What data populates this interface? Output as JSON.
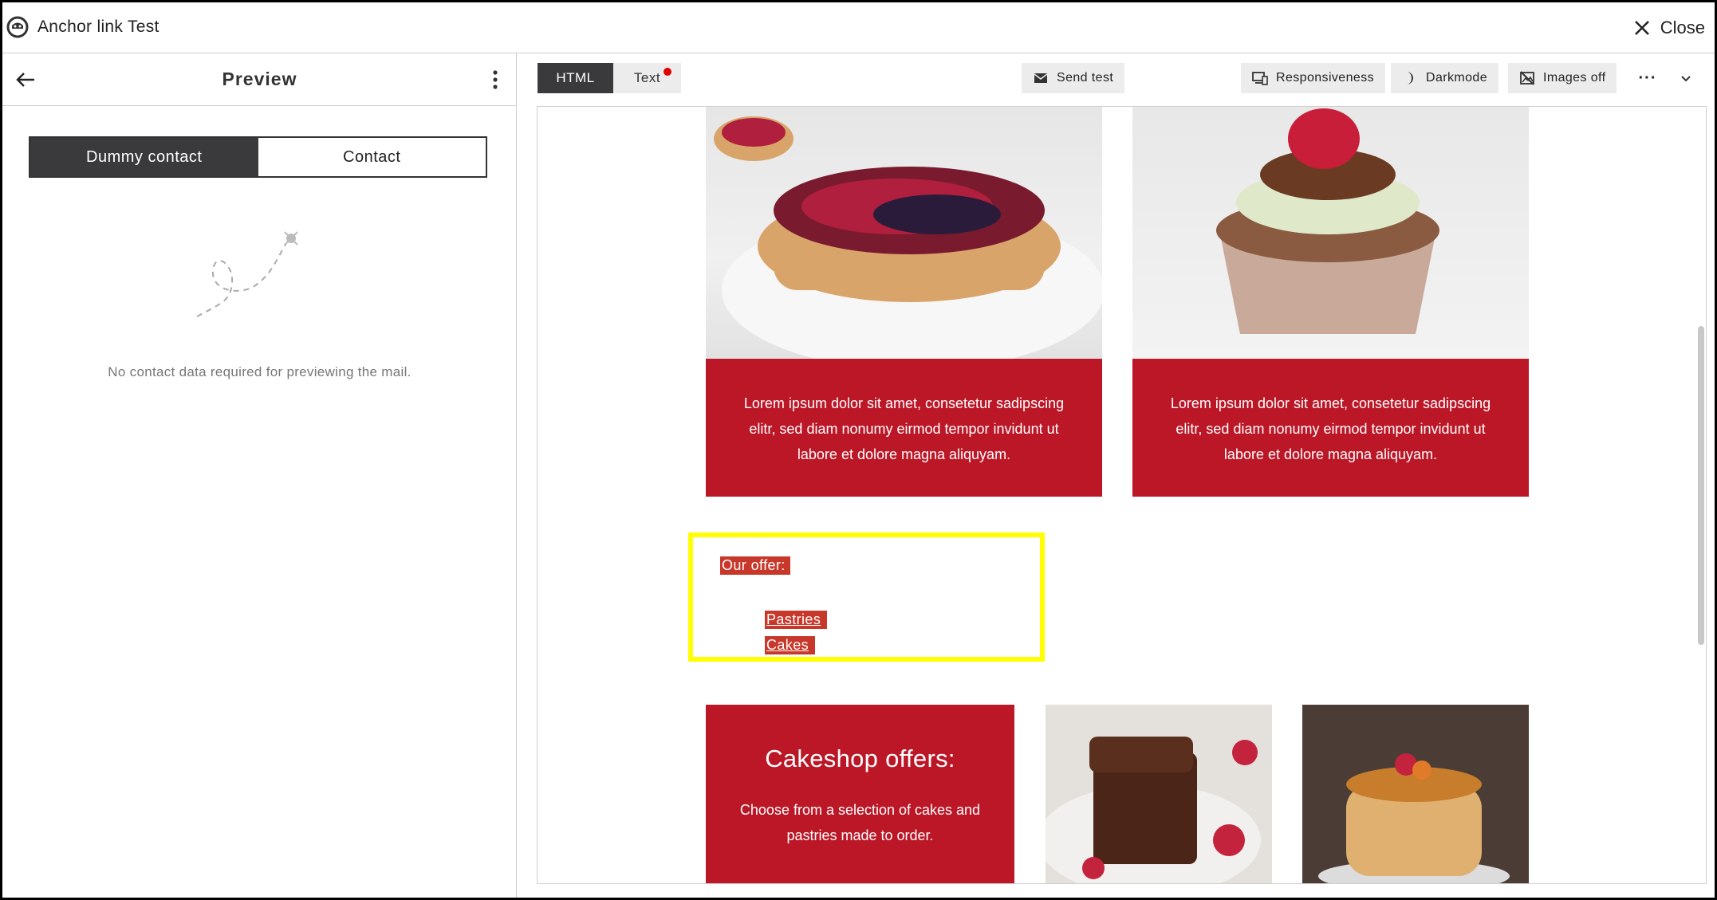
{
  "titlebar": {
    "title": "Anchor link Test",
    "close_label": "Close"
  },
  "left_panel": {
    "title": "Preview",
    "toggle": {
      "active_label": "Dummy contact",
      "inactive_label": "Contact"
    },
    "empty_message": "No contact data required for previewing the mail."
  },
  "toolbar": {
    "tab_html": "HTML",
    "tab_text": "Text",
    "send_test": "Send test",
    "responsiveness": "Responsiveness",
    "darkmode": "Darkmode",
    "images_off": "Images off",
    "more": "···"
  },
  "email": {
    "card1_text": "Lorem ipsum dolor sit amet, consetetur sadipscing elitr, sed diam nonumy eirmod tempor invidunt ut labore et dolore magna aliquyam.",
    "card2_text": "Lorem ipsum dolor sit amet, consetetur sadipscing elitr, sed diam nonumy eirmod tempor invidunt ut labore et dolore magna aliquyam.",
    "offer_label": "Our offer:",
    "links": [
      "Pastries",
      "Cakes"
    ],
    "cakeshop_title": "Cakeshop offers:",
    "cakeshop_text": "Choose from a selection of cakes and pastries made to order."
  },
  "colors": {
    "brand_red": "#bb1727",
    "highlight": "#ffff00",
    "link_bg": "#c8382a",
    "dark": "#3a3a3c"
  }
}
